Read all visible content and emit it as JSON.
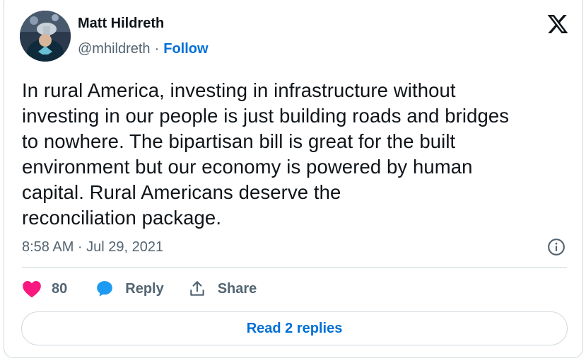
{
  "author": {
    "name": "Matt Hildreth",
    "handle": "@mhildreth",
    "separator": "·",
    "follow_label": "Follow"
  },
  "tweet": {
    "text": "In rural America, investing in infrastructure without\ninvesting in our people is just building roads and bridges\nto nowhere. The bipartisan bill is great for the built\nenvironment but our economy is powered by human\ncapital. Rural Americans deserve the\nreconciliation package.",
    "timestamp": "8:58 AM · Jul 29, 2021"
  },
  "actions": {
    "like_count": "80",
    "reply_label": "Reply",
    "share_label": "Share",
    "read_replies_label": "Read 2 replies"
  },
  "icons": {
    "brand": "x-logo-icon",
    "info": "info-icon",
    "like": "heart-icon",
    "reply": "speech-bubble-icon",
    "share": "share-icon"
  },
  "colors": {
    "like": "#f91880",
    "reply": "#1d9bf0",
    "link": "#006fd6",
    "secondary_text": "#536471",
    "border": "#cfd9de"
  }
}
